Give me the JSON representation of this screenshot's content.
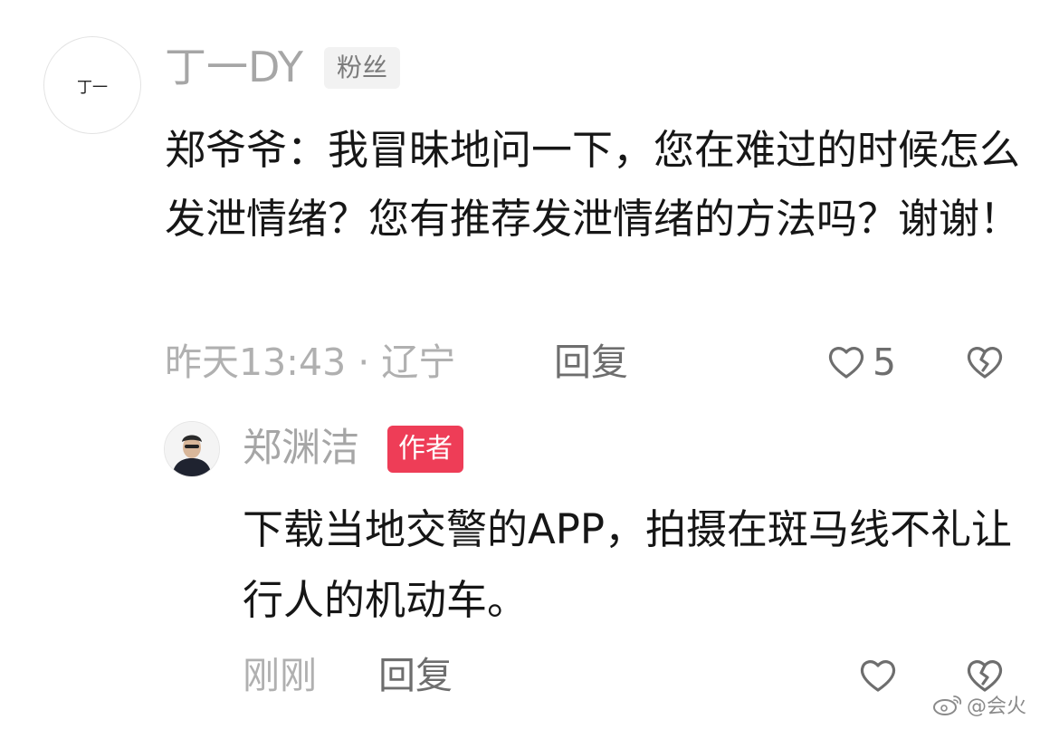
{
  "comment": {
    "avatar_text": "丁一",
    "username": "丁一DY",
    "badge": "粉丝",
    "text": "郑爷爷：我冒昧地问一下，您在难过的时候怎么发泄情绪？您有推荐发泄情绪的方法吗？谢谢！",
    "time_location": "昨天13:43 · 辽宁",
    "reply_label": "回复",
    "like_count": "5",
    "like_icon": "heart-outline-icon",
    "dislike_icon": "broken-heart-icon"
  },
  "reply": {
    "username": "郑渊洁",
    "badge": "作者",
    "text": "下载当地交警的APP，拍摄在斑马线不礼让行人的机动车。",
    "time": "刚刚",
    "reply_label": "回复",
    "like_icon": "heart-outline-icon",
    "dislike_icon": "broken-heart-icon"
  },
  "watermark": {
    "text": "@会火",
    "icon": "weibo-logo-icon"
  },
  "colors": {
    "author_badge": "#ee3d57",
    "fan_badge_bg": "#f2f2f2",
    "muted_text": "#a6a6a6"
  }
}
